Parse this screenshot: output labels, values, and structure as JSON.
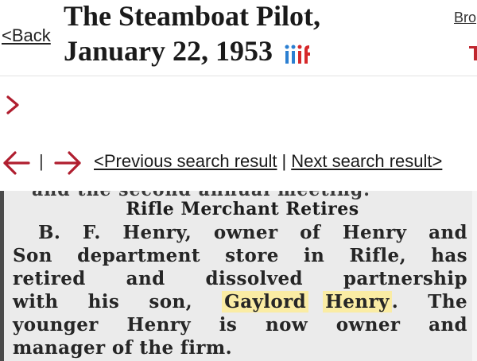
{
  "header": {
    "back_label": "<Back",
    "title_line1": "The Steamboat Pilot,",
    "title_line2": "January 22, 1953",
    "iiif_logo_text": "iiif",
    "browse_label": "Bro",
    "iiif_logo_colors": {
      "blue": "#2b7fd1",
      "red": "#d6282a"
    }
  },
  "navigation": {
    "pipe": "|",
    "previous_label": "<Previous search result",
    "separator": "|",
    "next_label": "Next search result>",
    "arrow_color": "#b01e2f"
  },
  "clipping": {
    "top_cut_text": "and the second annual meeting.",
    "headline": "Rifle Merchant Retires",
    "lines": [
      "B. F. Henry, owner of Henry and",
      "Son department store in Rifle, has",
      "retired and dissolved partnership",
      "with his son,",
      "younger Henry is now owner and",
      "manager of the firm."
    ],
    "highlight_1": "Gaylord",
    "highlight_2": "Henry",
    "line4_tail": ". The"
  }
}
